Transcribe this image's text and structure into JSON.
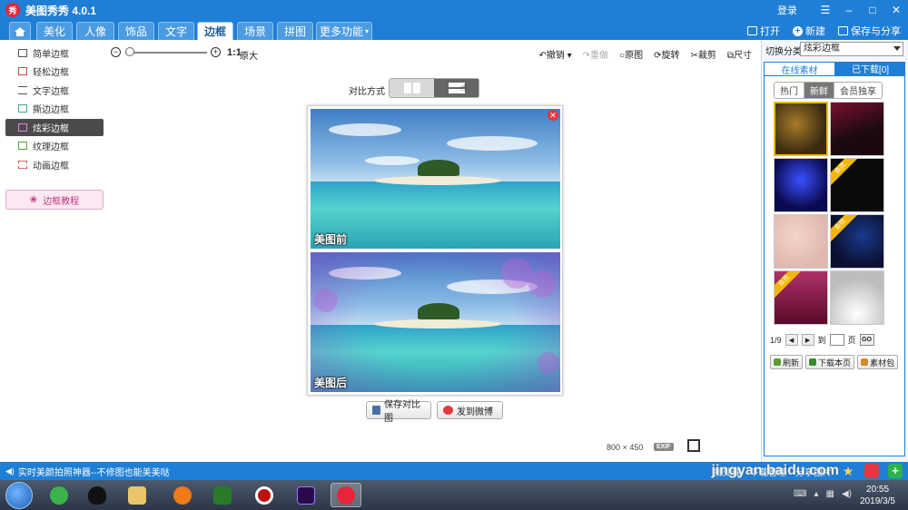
{
  "app": {
    "logo_text": "秀",
    "title": "美图秀秀 4.0.1",
    "login": "登录"
  },
  "tabs": [
    {
      "label": "美化"
    },
    {
      "label": "人像"
    },
    {
      "label": "饰品"
    },
    {
      "label": "文字"
    },
    {
      "label": "边框"
    },
    {
      "label": "场景"
    },
    {
      "label": "拼图"
    },
    {
      "label": "更多功能"
    }
  ],
  "top_actions": {
    "open": "打开",
    "new": "新建",
    "save_share": "保存与分享"
  },
  "sidebar": {
    "items": [
      {
        "label": "简单边框"
      },
      {
        "label": "轻松边框"
      },
      {
        "label": "文字边框"
      },
      {
        "label": "撕边边框"
      },
      {
        "label": "炫彩边框"
      },
      {
        "label": "纹理边框"
      },
      {
        "label": "动画边框"
      }
    ],
    "tutorial": "边框教程"
  },
  "toolbar": {
    "zoom_level": 0,
    "ratio": "1:1",
    "orig_size": "原大",
    "undo": "撤销",
    "redo": "重做",
    "original": "原图",
    "rotate": "旋转",
    "crop": "裁剪",
    "resize": "尺寸"
  },
  "compare": {
    "label": "对比方式"
  },
  "canvas": {
    "before_label": "美图前",
    "after_label": "美图后",
    "save_compare": "保存对比图",
    "send_weibo": "发到微博",
    "dim_w": "800",
    "dim_x": "×",
    "dim_h": "450",
    "exif": "EXIF"
  },
  "right_panel": {
    "category_label": "切换分类",
    "category_value": "炫彩边框",
    "tab_online": "在线素材",
    "tab_downloaded": "已下载[0]",
    "filters": [
      "热门",
      "新鲜",
      "会员独享"
    ],
    "badge": "会员",
    "page_info": "1/9",
    "goto_label": "到",
    "page_unit": "页",
    "go": "GO",
    "refresh": "刷新",
    "download_page": "下载本页",
    "material_pack": "素材包"
  },
  "statusbar": {
    "message": "实时美颜拍照神器--不修图也能美美哒",
    "batch": "批处理",
    "download_mgr": "下载管理",
    "share_pic": "分享图片"
  },
  "watermark": "jingyan.baidu.com",
  "taskbar": {
    "time": "20:55",
    "date": "2019/3/5"
  },
  "colors": {
    "accent": "#1f7fd6",
    "close_red": "#e03a3a",
    "vip_badge": "#f2b705"
  }
}
